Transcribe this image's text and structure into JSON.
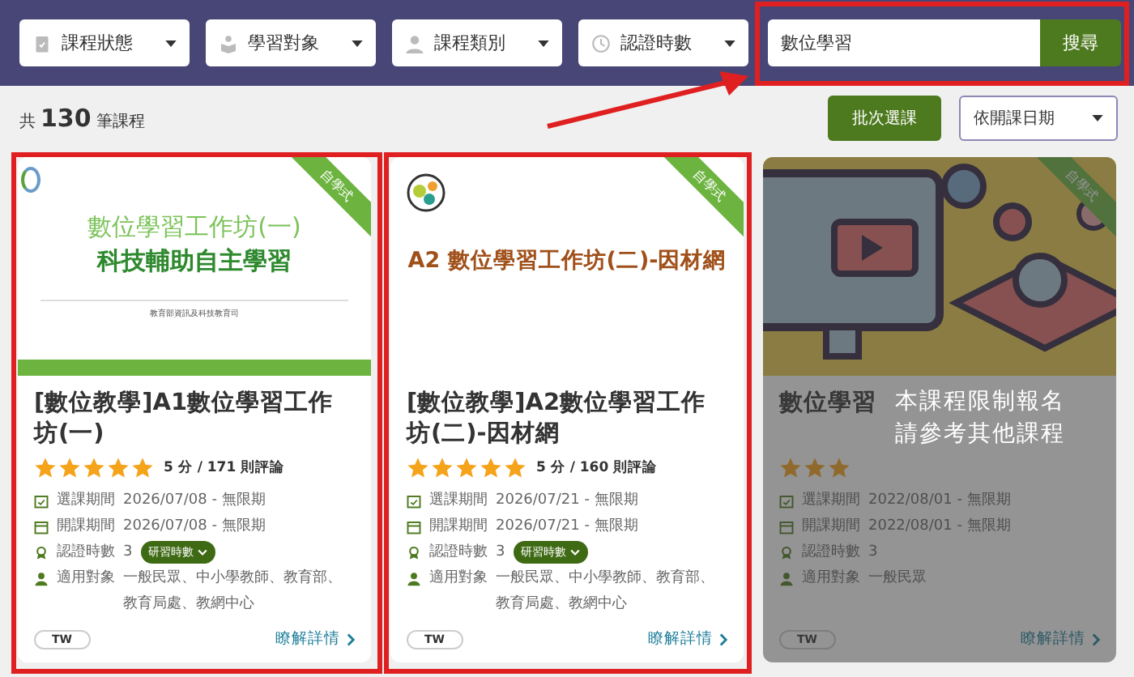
{
  "filters": [
    {
      "label": "課程狀態"
    },
    {
      "label": "學習對象"
    },
    {
      "label": "課程類別"
    },
    {
      "label": "認證時數"
    }
  ],
  "search": {
    "value": "數位學習",
    "button": "搜尋"
  },
  "summary": {
    "prefix": "共",
    "count": "130",
    "suffix": "筆課程"
  },
  "batch_button": "批次選課",
  "sort": {
    "value": "依開課日期"
  },
  "cards": [
    {
      "ribbon": "自學式",
      "thumbnail": {
        "kind": "banner",
        "lines": [
          "數位學習工作坊(一)",
          "科技輔助自主學習"
        ],
        "footer": "教育部資訊及科技教育司"
      },
      "title": "[數位教學]A1數位學習工作坊(一)",
      "stars": 5,
      "rating": "5 分 / 171 則評論",
      "restricted": false,
      "info": [
        {
          "label": "選課期間",
          "value": "2026/07/08 - 無限期"
        },
        {
          "label": "開課期間",
          "value": "2026/07/08 - 無限期"
        },
        {
          "label": "認證時數",
          "value": "3",
          "badge": "研習時數"
        },
        {
          "label": "適用對象",
          "value": "一般民眾、中小學教師、教育部、教育局處、教網中心"
        }
      ],
      "language": "TW",
      "link": "瞭解詳情"
    },
    {
      "ribbon": "自學式",
      "thumbnail": {
        "kind": "headline",
        "lines": [
          "A2 數位學習工作坊(二)-因材網"
        ]
      },
      "title": "[數位教學]A2數位學習工作坊(二)-因材網",
      "stars": 5,
      "rating": "5 分 / 160 則評論",
      "restricted": false,
      "info": [
        {
          "label": "選課期間",
          "value": "2026/07/21 - 無限期"
        },
        {
          "label": "開課期間",
          "value": "2026/07/21 - 無限期"
        },
        {
          "label": "認證時數",
          "value": "3",
          "badge": "研習時數"
        },
        {
          "label": "適用對象",
          "value": "一般民眾、中小學教師、教育部、教育局處、教網中心"
        }
      ],
      "language": "TW",
      "link": "瞭解詳情"
    },
    {
      "ribbon": "自學式",
      "thumbnail": {
        "kind": "illustration"
      },
      "title": "數位學習",
      "stars": 3,
      "restricted": true,
      "notice": [
        "本課程限制報名",
        "請參考其他課程"
      ],
      "info": [
        {
          "label": "選課期間",
          "value": "2022/08/01 - 無限期"
        },
        {
          "label": "開課期間",
          "value": "2022/08/01 - 無限期"
        },
        {
          "label": "認證時數",
          "value": "3"
        },
        {
          "label": "適用對象",
          "value": "一般民眾"
        }
      ],
      "language": "TW",
      "link": "瞭解詳情"
    }
  ]
}
